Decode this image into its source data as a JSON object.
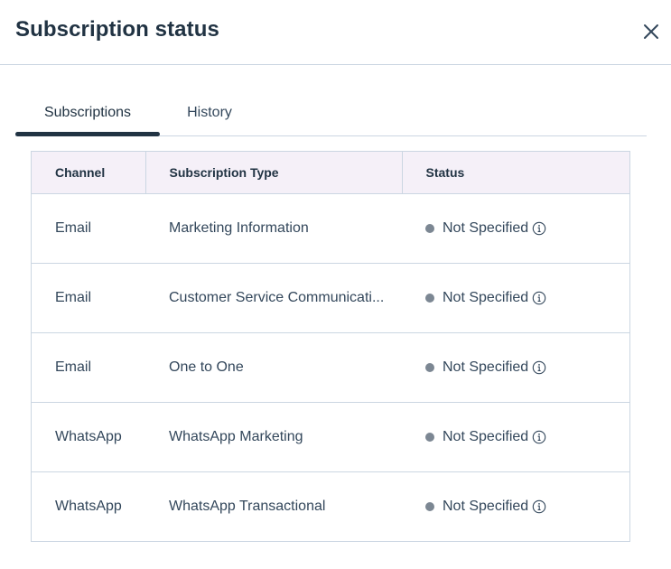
{
  "dialog": {
    "title": "Subscription status",
    "close_icon": "close-icon"
  },
  "tabs": [
    {
      "label": "Subscriptions",
      "selected": true
    },
    {
      "label": "History",
      "selected": false
    }
  ],
  "table": {
    "columns": [
      "Channel",
      "Subscription Type",
      "Status"
    ],
    "rows": [
      {
        "channel": "Email",
        "type": "Marketing Information",
        "status": "Not Specified"
      },
      {
        "channel": "Email",
        "type": "Customer Service Communicati...",
        "status": "Not Specified"
      },
      {
        "channel": "Email",
        "type": "One to One",
        "status": "Not Specified"
      },
      {
        "channel": "WhatsApp",
        "type": "WhatsApp Marketing",
        "status": "Not Specified"
      },
      {
        "channel": "WhatsApp",
        "type": "WhatsApp Transactional",
        "status": "Not Specified"
      }
    ],
    "status_icon": "info-icon"
  },
  "colors": {
    "text_dark": "#213343",
    "text": "#33475b",
    "border": "#cbd6e2",
    "header_bg": "#f5f0f8",
    "status_dot": "#7c8793"
  }
}
